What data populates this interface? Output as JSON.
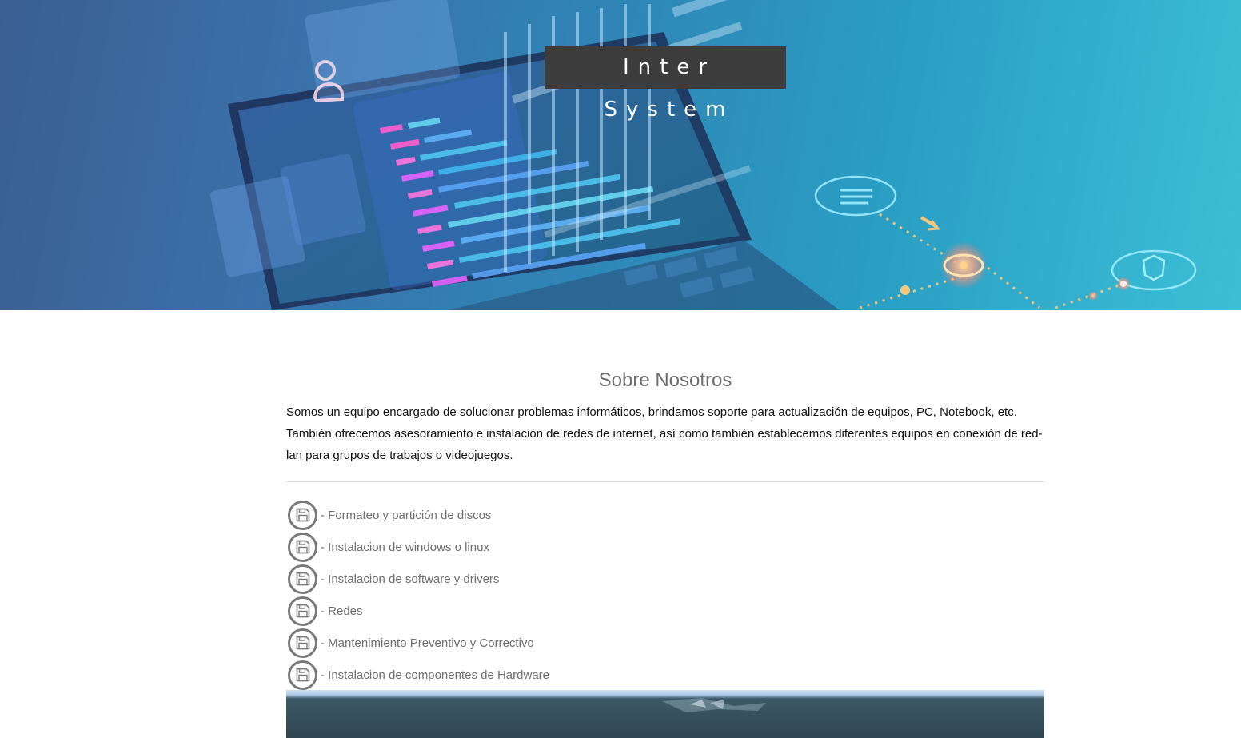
{
  "hero": {
    "title": "Inter System"
  },
  "about": {
    "title": "Sobre Nosotros",
    "description": "Somos un equipo encargado de solucionar problemas informáticos, brindamos soporte para actualización de equipos, PC, Notebook, etc. También ofrecemos asesoramiento e instalación de redes de internet, así como también establecemos diferentes equipos en conexión de red-lan para grupos de trabajos o videojuegos."
  },
  "services": {
    "icon": "floppy-disk-icon",
    "items": [
      {
        "label": "- Formateo y partición de discos"
      },
      {
        "label": "- Instalacion de windows o linux"
      },
      {
        "label": "- Instalacion de software y drivers"
      },
      {
        "label": "- Redes"
      },
      {
        "label": "- Mantenimiento Preventivo y Correctivo"
      },
      {
        "label": "- Instalacion de componentes de Hardware"
      }
    ]
  },
  "colors": {
    "title_box": "#3c3c3c",
    "heading_text": "#6e6e6e",
    "body_text": "#111111",
    "icon_ring": "#7a7a7a"
  }
}
